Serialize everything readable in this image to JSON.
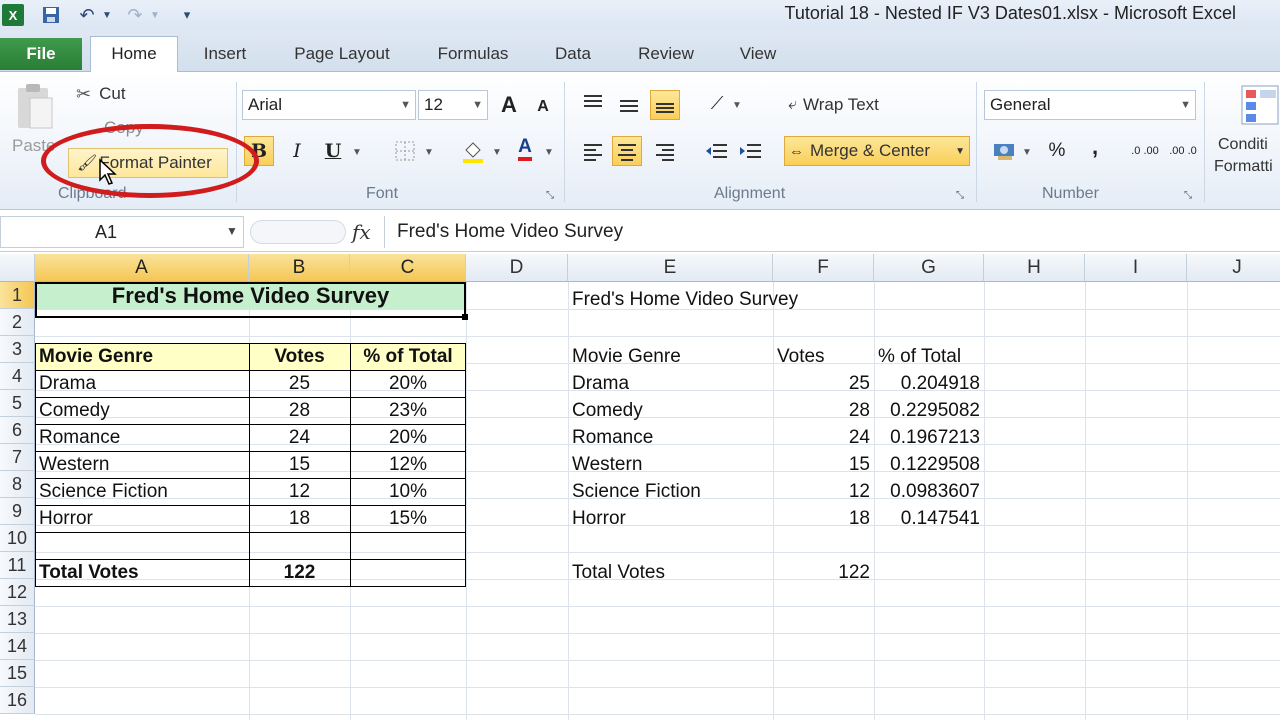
{
  "titlebar": {
    "app_icon": "X",
    "title": "Tutorial 18 - Nested IF V3 Dates01.xlsx - Microsoft Excel",
    "qat_icons": [
      "save-icon",
      "undo-icon",
      "redo-icon",
      "customize-qat-icon"
    ]
  },
  "tabs": [
    "File",
    "Home",
    "Insert",
    "Page Layout",
    "Formulas",
    "Data",
    "Review",
    "View"
  ],
  "ribbon": {
    "clipboard": {
      "paste": "Paste",
      "cut": "Cut",
      "copy": "Copy",
      "format_painter": "Format Painter",
      "label": "Clipboard"
    },
    "font": {
      "font_name": "Arial",
      "font_size": "12",
      "bold": "B",
      "italic": "I",
      "underline": "U",
      "font_color_letter": "A",
      "grow_letter": "A",
      "shrink_letter": "A",
      "label": "Font"
    },
    "alignment": {
      "wrap_text": "Wrap Text",
      "merge_center": "Merge & Center",
      "label": "Alignment"
    },
    "number": {
      "format": "General",
      "percent": "%",
      "comma": ",",
      "increase_decimal": ".0 .00",
      "decrease_decimal": ".00 .0",
      "label": "Number"
    },
    "styles": {
      "conditional_line1": "Conditi",
      "conditional_line2": "Formatti"
    }
  },
  "formula_bar": {
    "name_box": "A1",
    "fx": "fx",
    "content": "Fred's Home Video Survey"
  },
  "grid": {
    "columns": [
      "A",
      "B",
      "C",
      "D",
      "E",
      "F",
      "G",
      "H",
      "I",
      "J"
    ],
    "rows": [
      "1",
      "2",
      "3",
      "4",
      "5",
      "6",
      "7",
      "8",
      "9",
      "10",
      "11",
      "12",
      "13",
      "14",
      "15",
      "16"
    ],
    "left_table": {
      "title": "Fred's Home Video Survey",
      "headers": [
        "Movie Genre",
        "Votes",
        "% of Total"
      ],
      "rows": [
        [
          "Drama",
          "25",
          "20%"
        ],
        [
          "Comedy",
          "28",
          "23%"
        ],
        [
          "Romance",
          "24",
          "20%"
        ],
        [
          "Western",
          "15",
          "12%"
        ],
        [
          "Science Fiction",
          "12",
          "10%"
        ],
        [
          "Horror",
          "18",
          "15%"
        ]
      ],
      "total_label": "Total Votes",
      "total_value": "122"
    },
    "right_table": {
      "title": "Fred's Home Video Survey",
      "headers": [
        "Movie Genre",
        "Votes",
        "% of Total"
      ],
      "rows": [
        [
          "Drama",
          "25",
          "0.204918"
        ],
        [
          "Comedy",
          "28",
          "0.2295082"
        ],
        [
          "Romance",
          "24",
          "0.1967213"
        ],
        [
          "Western",
          "15",
          "0.1229508"
        ],
        [
          "Science Fiction",
          "12",
          "0.0983607"
        ],
        [
          "Horror",
          "18",
          "0.147541"
        ]
      ],
      "total_label": "Total Votes",
      "total_value": "122"
    }
  },
  "colors": {
    "highlight_ring": "#d01c1c",
    "header_fill": "#ffffc6",
    "title_fill": "#c6efce",
    "file_tab": "#2a7d36"
  }
}
